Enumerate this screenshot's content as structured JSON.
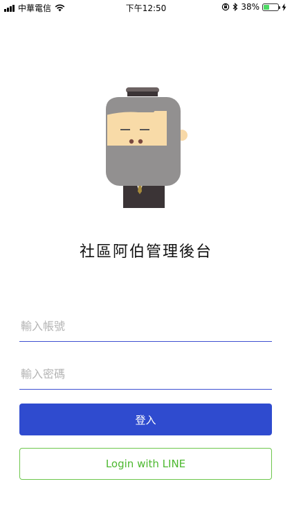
{
  "status_bar": {
    "carrier": "中華電信",
    "time": "下午12:50",
    "battery_percent": "38%",
    "battery_level": 0.38
  },
  "app": {
    "title": "社區阿伯管理後台"
  },
  "form": {
    "account_placeholder": "輸入帳號",
    "password_placeholder": "輸入密碼",
    "login_label": "登入",
    "line_login_label": "Login with LINE"
  },
  "colors": {
    "primary": "#2f4bcf",
    "line_green": "#4cb82f",
    "input_underline": "#3d4fd1"
  }
}
